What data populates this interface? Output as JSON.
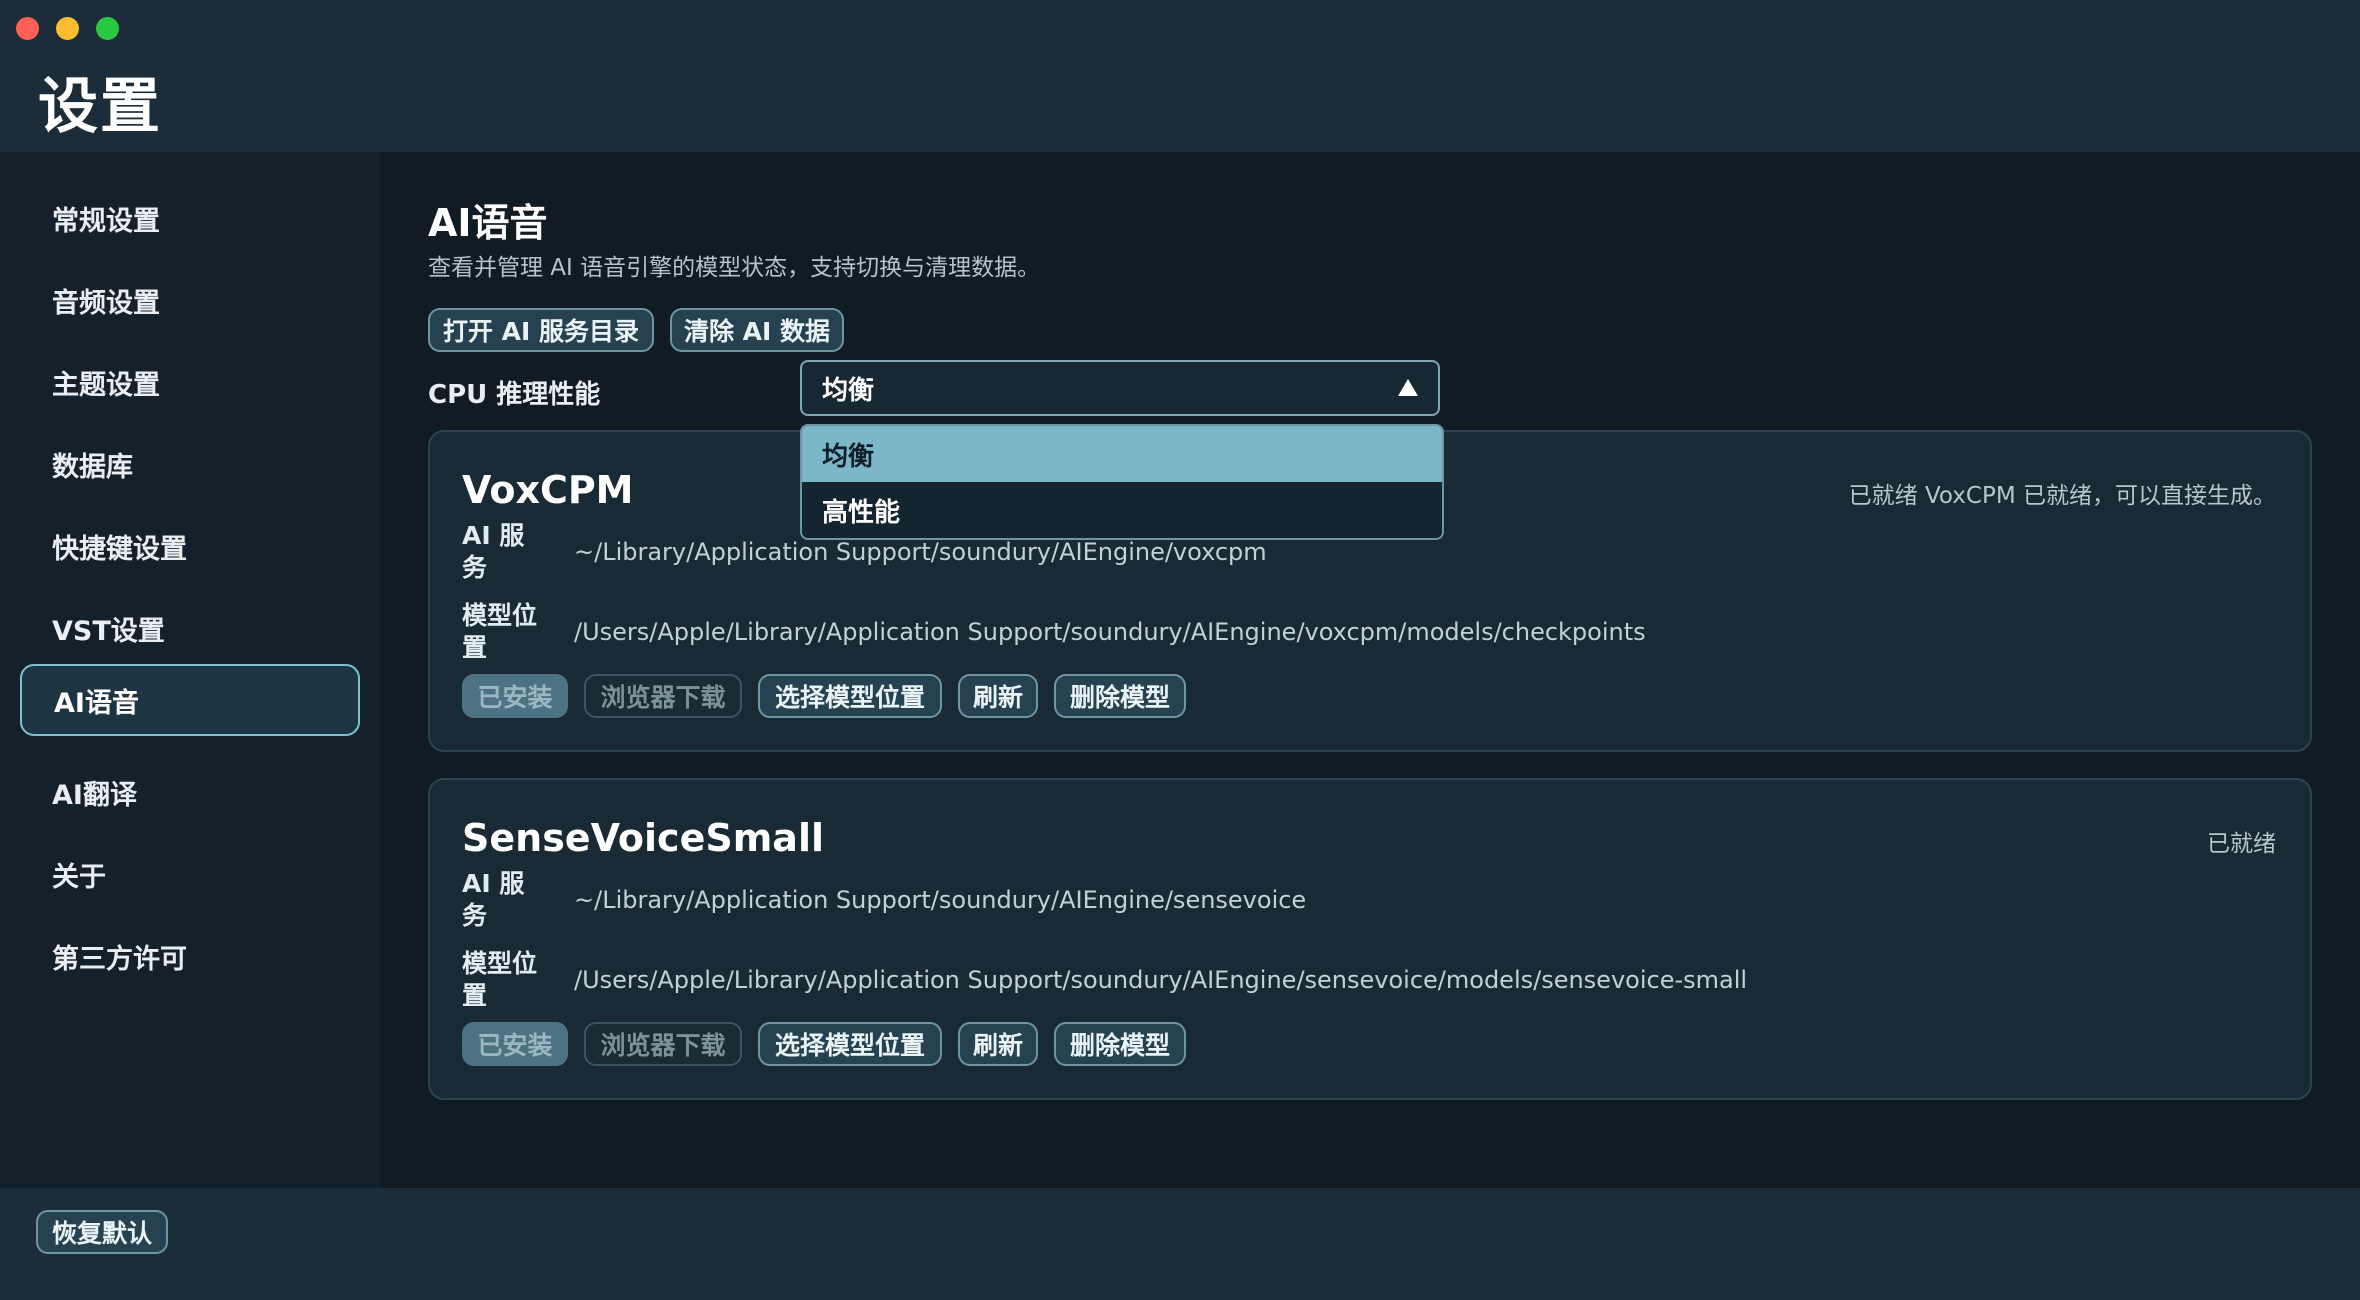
{
  "window": {
    "title": "设置"
  },
  "sidebar": {
    "items": [
      {
        "label": "常规设置"
      },
      {
        "label": "音频设置"
      },
      {
        "label": "主题设置"
      },
      {
        "label": "数据库"
      },
      {
        "label": "快捷键设置"
      },
      {
        "label": "VST设置"
      },
      {
        "label": "AI语音",
        "active": true
      },
      {
        "label": "AI翻译"
      },
      {
        "label": "关于"
      },
      {
        "label": "第三方许可"
      }
    ]
  },
  "main": {
    "title": "AI语音",
    "description": "查看并管理 AI 语音引擎的模型状态，支持切换与清理数据。",
    "open_dir_label": "打开 AI 服务目录",
    "clear_data_label": "清除 AI 数据",
    "cpu_label": "CPU 推理性能",
    "cpu_select": {
      "value": "均衡",
      "options": [
        "均衡",
        "高性能"
      ]
    },
    "engines": [
      {
        "name": "VoxCPM",
        "status": "已就绪 VoxCPM 已就绪，可以直接生成。",
        "service_label": "AI 服务",
        "service_path": "~/Library/Application Support/soundury/AIEngine/voxcpm",
        "model_label": "模型位置",
        "model_path": "/Users/Apple/Library/Application Support/soundury/AIEngine/voxcpm/models/checkpoints",
        "buttons": {
          "installed": "已安装",
          "browser_download": "浏览器下载",
          "choose_location": "选择模型位置",
          "refresh": "刷新",
          "delete": "删除模型"
        }
      },
      {
        "name": "SenseVoiceSmall",
        "status": "已就绪",
        "service_label": "AI 服务",
        "service_path": "~/Library/Application Support/soundury/AIEngine/sensevoice",
        "model_label": "模型位置",
        "model_path": "/Users/Apple/Library/Application Support/soundury/AIEngine/sensevoice/models/sensevoice-small",
        "buttons": {
          "installed": "已安装",
          "browser_download": "浏览器下载",
          "choose_location": "选择模型位置",
          "refresh": "刷新",
          "delete": "删除模型"
        }
      }
    ]
  },
  "footer": {
    "reset_label": "恢复默认"
  },
  "colors": {
    "accent": "#7bb7c8",
    "sidebar_bg": "#14212b",
    "content_bg": "#111b24",
    "card_bg": "#1a2a35"
  }
}
